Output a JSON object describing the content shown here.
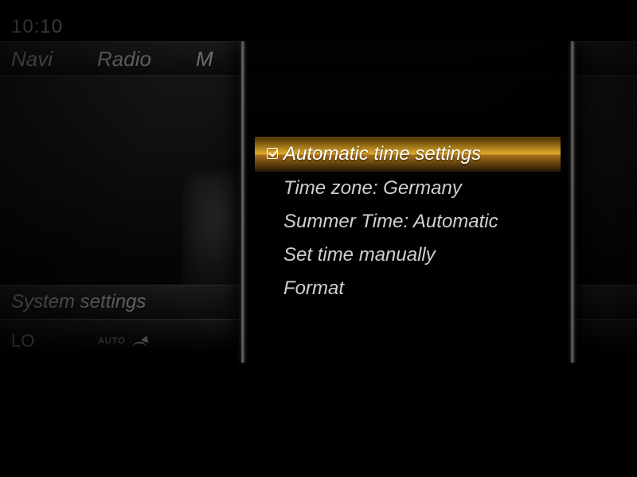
{
  "clock": "10:10",
  "tabs": {
    "navi": "Navi",
    "radio": "Radio",
    "media_initial": "M"
  },
  "breadcrumb": {
    "system_settings": "System settings"
  },
  "climate": {
    "lo": "LO",
    "auto_label": "AUTO"
  },
  "panel": {
    "items": [
      {
        "label": "Automatic time settings",
        "checked": true,
        "selected": true
      },
      {
        "label": "Time zone: Germany",
        "checked": false,
        "selected": false
      },
      {
        "label": "Summer Time: Automatic",
        "checked": false,
        "selected": false
      },
      {
        "label": "Set time manually",
        "checked": false,
        "selected": false
      },
      {
        "label": "Format",
        "checked": false,
        "selected": false
      }
    ]
  },
  "colors": {
    "highlight_amber": "#d7a125",
    "text_dim": "#707070",
    "text_panel": "#cfcfcf"
  }
}
